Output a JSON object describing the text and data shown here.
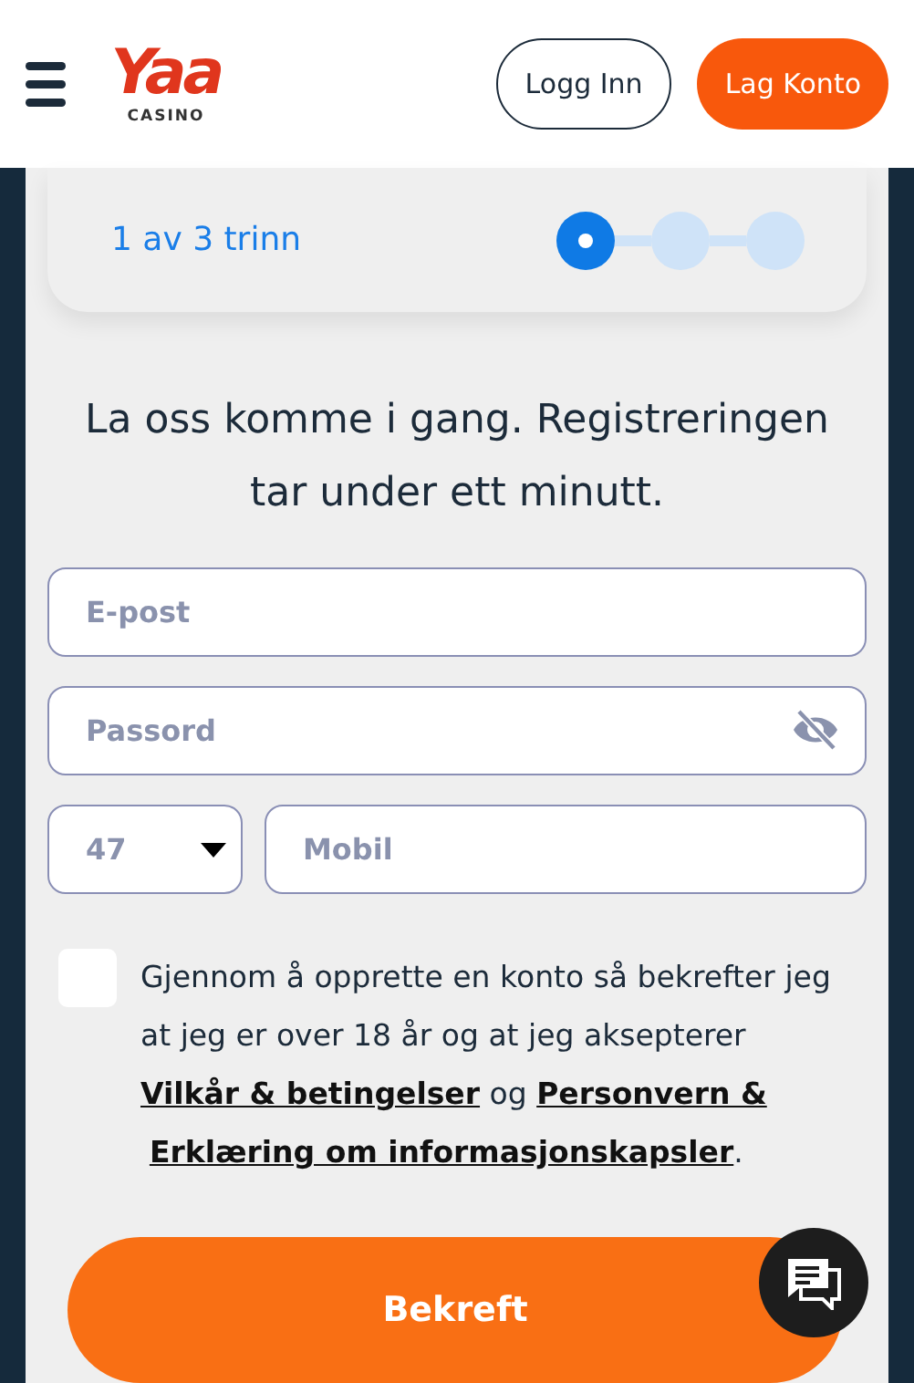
{
  "header": {
    "logo": {
      "wordmark": "Yaa",
      "tagline": "CASINO"
    },
    "buttons": [
      {
        "label": "Logg Inn",
        "kind": "outline"
      },
      {
        "label": "Lag Konto",
        "kind": "primary"
      }
    ]
  },
  "progress": {
    "label": "1 av 3 trinn",
    "steps": [
      {
        "selected": true
      },
      {
        "selected": false
      },
      {
        "selected": false
      }
    ]
  },
  "heading": "La oss komme i gang. Registreringen tar under ett minutt.",
  "fields": [
    {
      "placeholder": "E-post",
      "kind": "text"
    },
    {
      "placeholder": "Passord",
      "kind": "password"
    }
  ],
  "phone": {
    "code": "47",
    "placeholder": "Mobil"
  },
  "consent": {
    "checked": false,
    "segments": [
      {
        "kind": "text",
        "text": "Gjennom å opprette en konto så bekrefter jeg at jeg er over 18 år og at jeg aksepterer "
      },
      {
        "kind": "link",
        "text": "Vilkår & betingelser"
      },
      {
        "kind": "text",
        "text": " og "
      },
      {
        "kind": "link",
        "text": "Personvern &"
      },
      {
        "kind": "link",
        "text": "Erklæring om informasjonskapsler"
      },
      {
        "kind": "text",
        "text": "."
      }
    ]
  },
  "submit": "Bekreft"
}
